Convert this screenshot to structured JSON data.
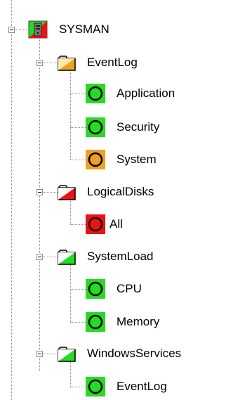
{
  "colors": {
    "ok": "#22dd22",
    "warning": "#f0a020",
    "error": "#ee1111"
  },
  "tree": {
    "root": {
      "label": "SYSMAN",
      "icon": "server-icon",
      "status": "mixed"
    },
    "groups": [
      {
        "label": "EventLog",
        "icon": "folder-icon",
        "status": "warning",
        "items": [
          {
            "label": "Application",
            "icon": "status-circle-icon",
            "status": "ok"
          },
          {
            "label": "Security",
            "icon": "status-circle-icon",
            "status": "ok"
          },
          {
            "label": "System",
            "icon": "status-circle-icon",
            "status": "warning"
          }
        ]
      },
      {
        "label": "LogicalDisks",
        "icon": "folder-icon",
        "status": "error",
        "items": [
          {
            "label": "All",
            "icon": "status-circle-icon",
            "status": "error"
          }
        ]
      },
      {
        "label": "SystemLoad",
        "icon": "folder-icon",
        "status": "ok",
        "items": [
          {
            "label": "CPU",
            "icon": "status-circle-icon",
            "status": "ok"
          },
          {
            "label": "Memory",
            "icon": "status-circle-icon",
            "status": "ok"
          }
        ]
      },
      {
        "label": "WindowsServices",
        "icon": "folder-icon",
        "status": "ok",
        "items": [
          {
            "label": "EventLog",
            "icon": "status-circle-icon",
            "status": "ok"
          }
        ]
      }
    ]
  }
}
